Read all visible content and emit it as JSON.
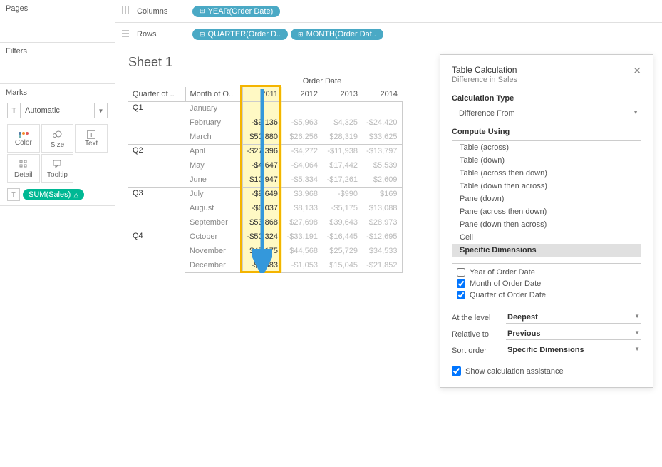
{
  "left": {
    "pages_label": "Pages",
    "filters_label": "Filters",
    "marks_label": "Marks",
    "marks_type": "Automatic",
    "marks_cells": [
      "Color",
      "Size",
      "Text",
      "Detail",
      "Tooltip"
    ],
    "sum_pill": "SUM(Sales)"
  },
  "shelves": {
    "columns_label": "Columns",
    "rows_label": "Rows",
    "columns_pills": [
      "YEAR(Order Date)"
    ],
    "rows_pills": [
      "QUARTER(Order D..",
      "MONTH(Order Dat.."
    ]
  },
  "sheet": {
    "title": "Sheet 1",
    "super_header": "Order Date",
    "corner_q": "Quarter of ..",
    "corner_m": "Month of O..",
    "years": [
      "2011",
      "2012",
      "2013",
      "2014"
    ],
    "rows": [
      {
        "q": "Q1",
        "m": "January",
        "v": [
          "",
          "",
          "",
          ""
        ]
      },
      {
        "q": "",
        "m": "February",
        "v": [
          "-$9,136",
          "-$5,963",
          "$4,325",
          "-$24,420"
        ]
      },
      {
        "q": "",
        "m": "March",
        "v": [
          "$50,880",
          "$26,256",
          "$28,319",
          "$33,625"
        ]
      },
      {
        "q": "Q2",
        "m": "April",
        "v": [
          "-$27,396",
          "-$4,272",
          "-$11,938",
          "-$13,797"
        ]
      },
      {
        "q": "",
        "m": "May",
        "v": [
          "-$4,647",
          "-$4,064",
          "$17,442",
          "$5,539"
        ]
      },
      {
        "q": "",
        "m": "June",
        "v": [
          "$10,947",
          "-$5,334",
          "-$17,261",
          "$2,609"
        ]
      },
      {
        "q": "Q3",
        "m": "July",
        "v": [
          "-$9,649",
          "$3,968",
          "-$990",
          "$169"
        ]
      },
      {
        "q": "",
        "m": "August",
        "v": [
          "-$6,037",
          "$8,133",
          "-$5,175",
          "$13,088"
        ]
      },
      {
        "q": "",
        "m": "September",
        "v": [
          "$53,868",
          "$27,698",
          "$39,643",
          "$28,973"
        ]
      },
      {
        "q": "Q4",
        "m": "October",
        "v": [
          "-$50,324",
          "-$33,191",
          "-$16,445",
          "-$12,695"
        ]
      },
      {
        "q": "",
        "m": "November",
        "v": [
          "$47,175",
          "$44,568",
          "$25,729",
          "$34,533"
        ]
      },
      {
        "q": "",
        "m": "December",
        "v": [
          "-$9,083",
          "-$1,053",
          "$15,045",
          "-$21,852"
        ]
      }
    ]
  },
  "tc": {
    "title": "Table Calculation",
    "subtitle": "Difference in Sales",
    "calc_type_label": "Calculation Type",
    "calc_type_value": "Difference From",
    "compute_label": "Compute Using",
    "compute_options": [
      "Table (across)",
      "Table (down)",
      "Table (across then down)",
      "Table (down then across)",
      "Pane (down)",
      "Pane (across then down)",
      "Pane (down then across)",
      "Cell",
      "Specific Dimensions"
    ],
    "compute_selected": "Specific Dimensions",
    "dims": [
      {
        "label": "Year of Order Date",
        "checked": false
      },
      {
        "label": "Month of Order Date",
        "checked": true
      },
      {
        "label": "Quarter of Order Date",
        "checked": true
      }
    ],
    "at_level_label": "At the level",
    "at_level_value": "Deepest",
    "relative_label": "Relative to",
    "relative_value": "Previous",
    "sort_label": "Sort order",
    "sort_value": "Specific Dimensions",
    "assist_label": "Show calculation assistance"
  }
}
